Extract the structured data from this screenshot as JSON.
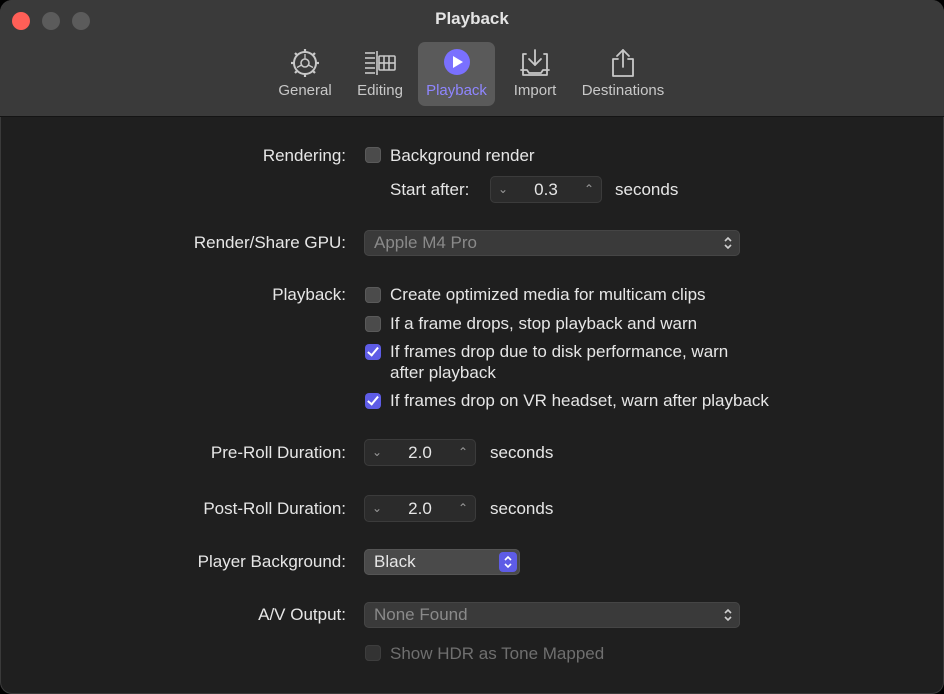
{
  "window": {
    "title": "Playback"
  },
  "toolbar": {
    "tabs": [
      {
        "label": "General",
        "icon": "gear-icon",
        "active": false
      },
      {
        "label": "Editing",
        "icon": "timeline-icon",
        "active": false
      },
      {
        "label": "Playback",
        "icon": "play-circle-icon",
        "active": true
      },
      {
        "label": "Import",
        "icon": "import-tray-icon",
        "active": false
      },
      {
        "label": "Destinations",
        "icon": "share-icon",
        "active": false
      }
    ]
  },
  "rendering": {
    "label": "Rendering:",
    "background_render": {
      "label": "Background render",
      "checked": false
    },
    "start_after": {
      "label": "Start after:",
      "value": "0.3",
      "unit": "seconds"
    }
  },
  "gpu": {
    "label": "Render/Share GPU:",
    "value": "Apple M4 Pro"
  },
  "playback": {
    "label": "Playback:",
    "options": [
      {
        "line1": "Create optimized media for multicam clips",
        "line2": "",
        "checked": false
      },
      {
        "line1": "If a frame drops, stop playback and warn",
        "line2": "",
        "checked": false
      },
      {
        "line1": "If frames drop due to disk performance, warn",
        "line2": "after playback",
        "checked": true
      },
      {
        "line1": "If frames drop on VR headset, warn after playback",
        "line2": "",
        "checked": true
      }
    ]
  },
  "preroll": {
    "label": "Pre-Roll Duration:",
    "value": "2.0",
    "unit": "seconds"
  },
  "postroll": {
    "label": "Post-Roll Duration:",
    "value": "2.0",
    "unit": "seconds"
  },
  "player_background": {
    "label": "Player Background:",
    "value": "Black"
  },
  "av_output": {
    "label": "A/V Output:",
    "value": "None Found"
  },
  "hdr": {
    "label": "Show HDR as Tone Mapped",
    "checked": false,
    "enabled": false
  },
  "colors": {
    "accent": "#5e5ce6",
    "active_tab_text": "#8f86ff",
    "background": "#1f1f1f"
  }
}
